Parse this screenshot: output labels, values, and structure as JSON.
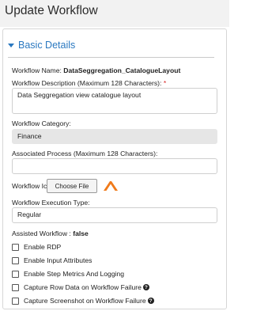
{
  "header": {
    "title": "Update Workflow"
  },
  "section": {
    "title": "Basic Details"
  },
  "workflow_name": {
    "label": "Workflow Name:",
    "value": "DataSeggregation_CatalogueLayout"
  },
  "description": {
    "label": "Workflow Description (Maximum 128 Characters):",
    "required": "*",
    "value": "Data Seggregation view catalogue layout"
  },
  "category": {
    "label": "Workflow Category:",
    "value": "Finance"
  },
  "process": {
    "label": "Associated Process (Maximum 128 Characters):",
    "value": ""
  },
  "icon": {
    "label": "Workflow Icon:",
    "button": "Choose File"
  },
  "execution": {
    "label": "Workflow Execution Type:",
    "value": "Regular"
  },
  "assisted": {
    "label": "Assisted Workflow :",
    "value": "false"
  },
  "checkboxes": [
    {
      "label": "Enable RDP",
      "help": ""
    },
    {
      "label": "Enable Input Attributes",
      "help": ""
    },
    {
      "label": "Enable Step Metrics And Logging",
      "help": ""
    },
    {
      "label": "Capture Row Data on Workflow Failure",
      "help": "?"
    },
    {
      "label": "Capture Screenshot on Workflow Failure",
      "help": "?"
    }
  ],
  "colors": {
    "accent": "#2a78c0",
    "required": "#d62020",
    "icon": "#f07a1a"
  }
}
